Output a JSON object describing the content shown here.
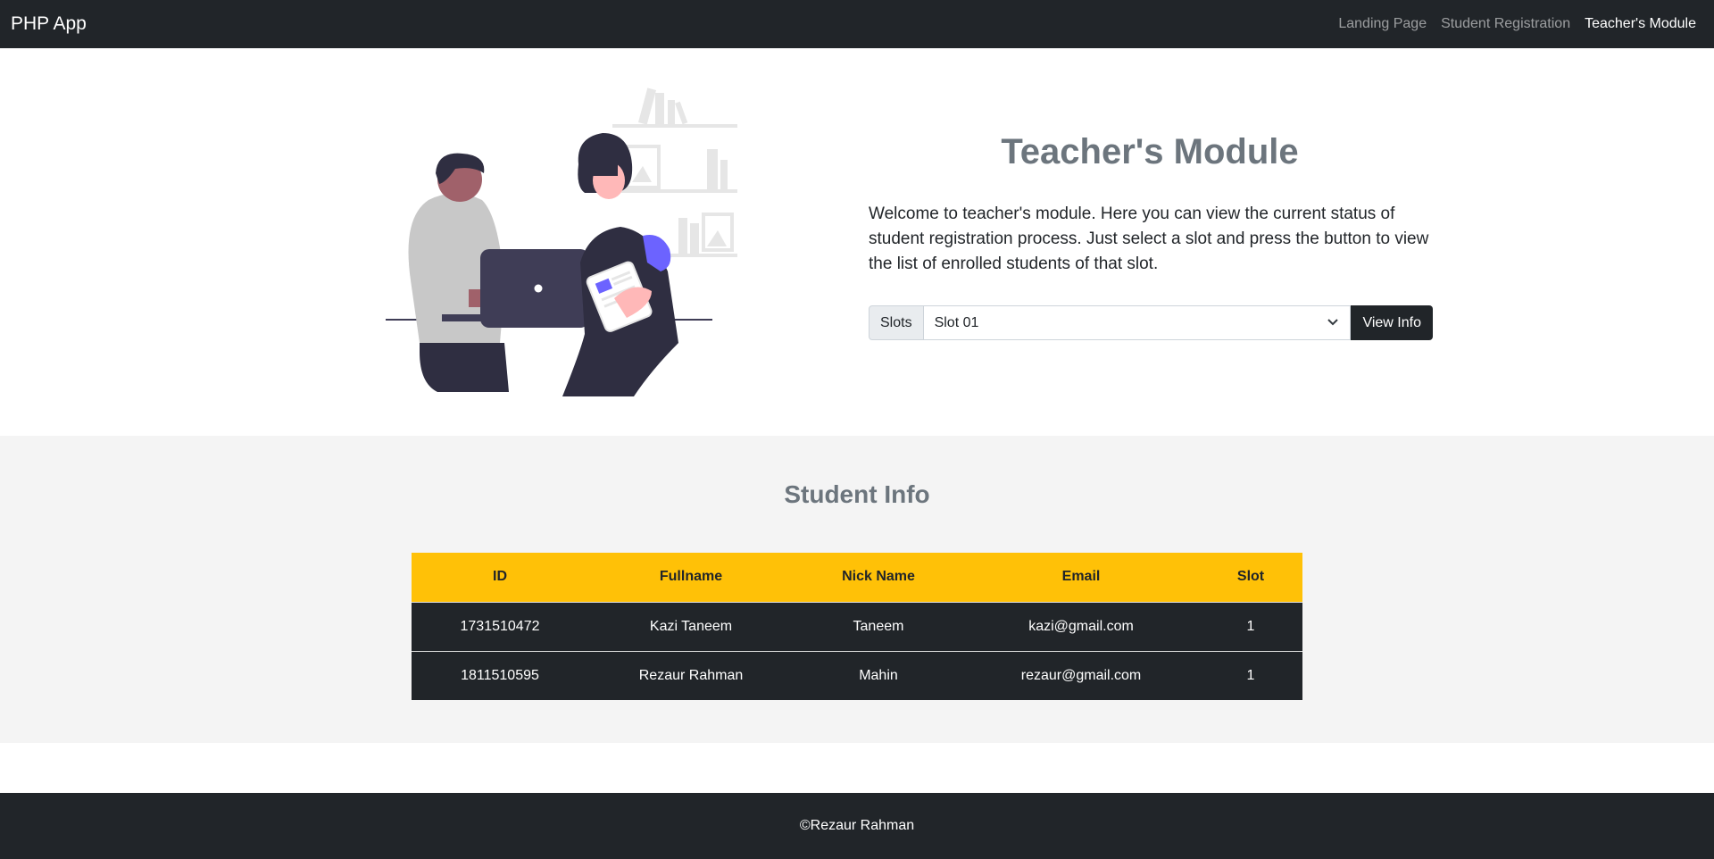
{
  "navbar": {
    "brand": "PHP App",
    "links": [
      {
        "label": "Landing Page"
      },
      {
        "label": "Student Registration"
      },
      {
        "label": "Teacher's Module"
      }
    ]
  },
  "hero": {
    "title": "Teacher's Module",
    "description": "Welcome to teacher's module. Here you can view the current status of student registration process. Just select a slot and press the button to view the list of enrolled students of that slot.",
    "slots_label": "Slots",
    "slot_selected": "Slot 01",
    "view_button": "View Info"
  },
  "student_info": {
    "title": "Student Info",
    "columns": [
      "ID",
      "Fullname",
      "Nick Name",
      "Email",
      "Slot"
    ],
    "rows": [
      [
        "1731510472",
        "Kazi Taneem",
        "Taneem",
        "kazi@gmail.com",
        "1"
      ],
      [
        "1811510595",
        "Rezaur Rahman",
        "Mahin",
        "rezaur@gmail.com",
        "1"
      ]
    ]
  },
  "footer": {
    "text": "©Rezaur Rahman"
  },
  "colors": {
    "navbar": "#212529",
    "accent": "#ffc107",
    "section_bg": "#f4f4f4",
    "muted_heading": "#6c757d"
  }
}
